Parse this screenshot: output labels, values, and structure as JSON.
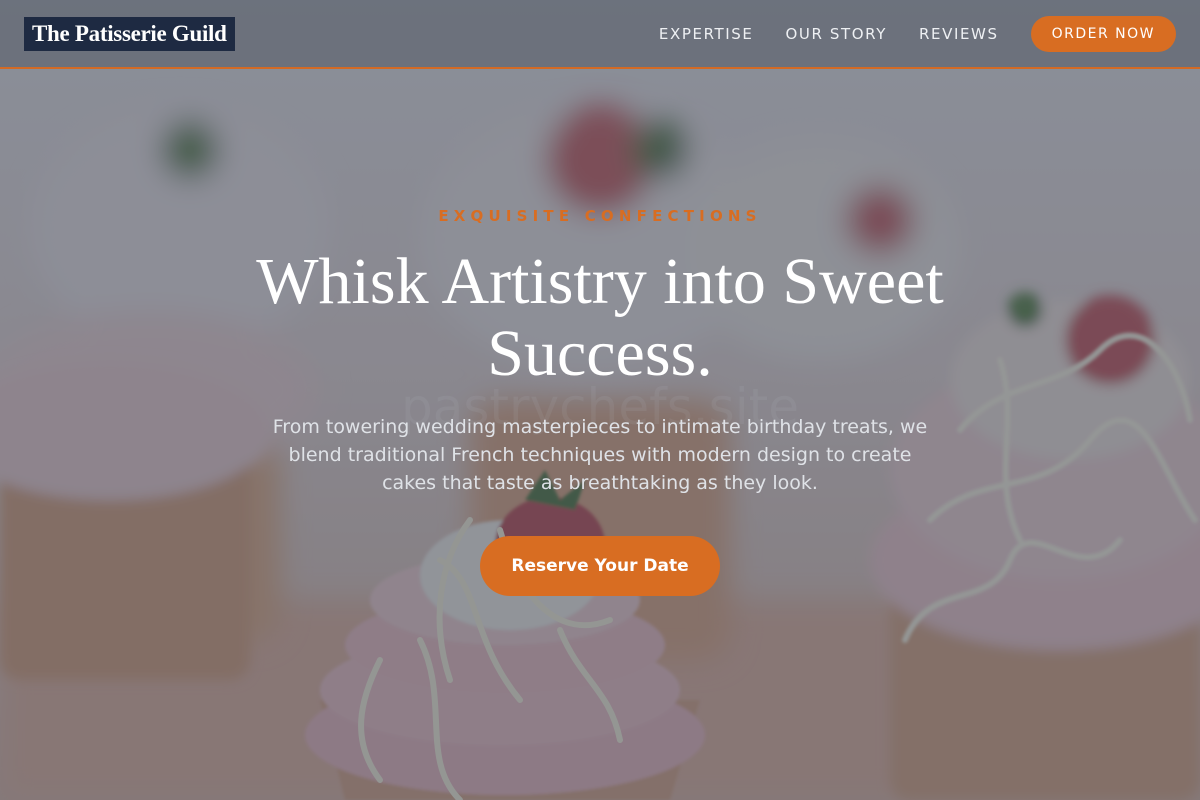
{
  "colors": {
    "accent": "#d86d22",
    "logo_background": "#1e2a42",
    "overlay": "#464e5c"
  },
  "nav": {
    "logo_text": "The Patisserie Guild",
    "links": [
      {
        "label": "EXPERTISE"
      },
      {
        "label": "OUR STORY"
      },
      {
        "label": "REVIEWS"
      }
    ],
    "order_button": "ORDER NOW"
  },
  "hero": {
    "eyebrow": "EXQUISITE CONFECTIONS",
    "headline_line1": "Whisk Artistry into Sweet",
    "headline_line2": "Success.",
    "subtext": "From towering wedding masterpieces to intimate birthday treats, we blend traditional French techniques with modern design to create cakes that taste as breathtaking as they look.",
    "cta_label": "Reserve Your Date",
    "watermark": "pastrychefs.site"
  },
  "background_image": {
    "subject": "cupcakes with pink buttercream frosting, white chocolate drizzle and strawberries",
    "icon": "cupcake-photo"
  }
}
